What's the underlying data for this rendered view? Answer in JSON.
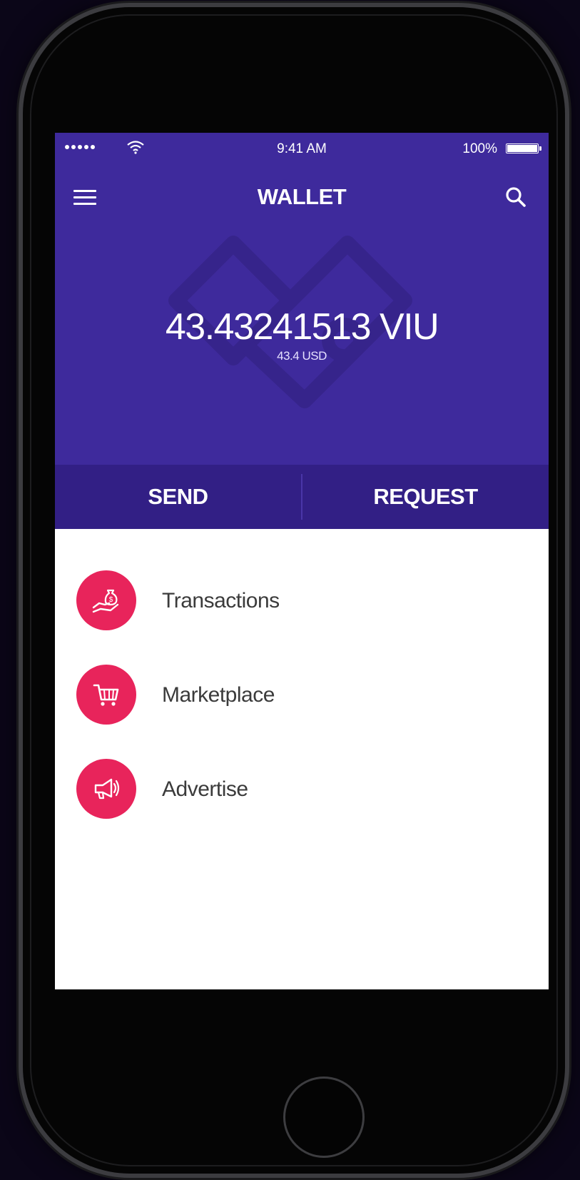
{
  "status_bar": {
    "time": "9:41 AM",
    "battery": "100%",
    "battery_level": 1.0
  },
  "nav": {
    "title": "WALLET",
    "menu_icon": "hamburger-menu-icon",
    "search_icon": "search-icon"
  },
  "balance": {
    "amount": "43.43241513 VIU",
    "usd": "43.4 USD"
  },
  "actions": {
    "send_label": "SEND",
    "request_label": "REQUEST"
  },
  "menu": {
    "items": [
      {
        "label": "Transactions",
        "icon": "hand-money-bag-icon"
      },
      {
        "label": "Marketplace",
        "icon": "shopping-cart-icon"
      },
      {
        "label": "Advertise",
        "icon": "megaphone-icon"
      }
    ]
  },
  "colors": {
    "header": "#3e2a9c",
    "action_bar": "#321f85",
    "accent": "#e8245b",
    "background": "#0b0618"
  }
}
